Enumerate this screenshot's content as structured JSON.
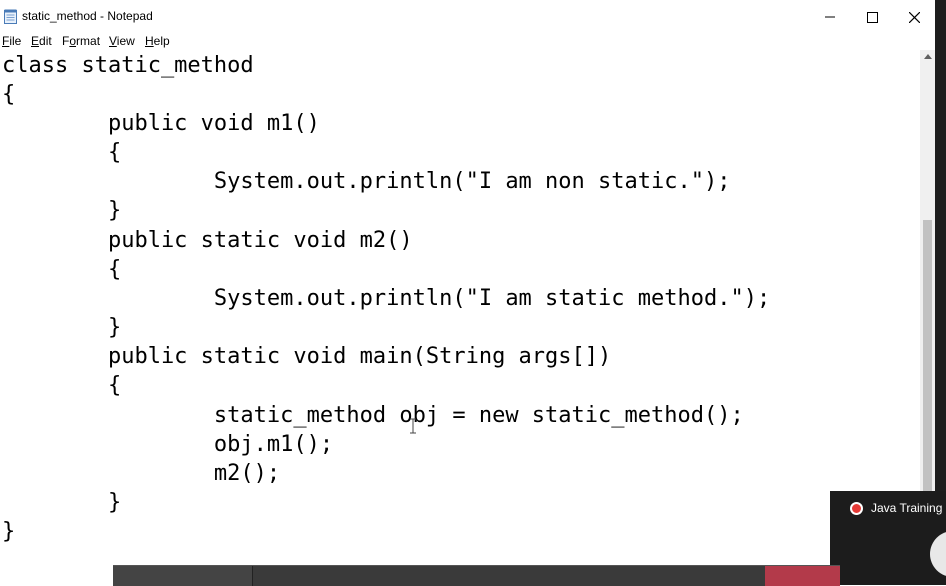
{
  "window": {
    "title": "static_method - Notepad",
    "controls": [
      "minimize",
      "maximize",
      "close"
    ]
  },
  "menu": {
    "items": [
      {
        "label": "File",
        "underline": "F",
        "rest": "ile"
      },
      {
        "label": "Edit",
        "underline": "E",
        "rest": "dit"
      },
      {
        "label": "Format",
        "underline": "o",
        "pre": "F",
        "rest": "rmat"
      },
      {
        "label": "View",
        "underline": "V",
        "rest": "iew"
      },
      {
        "label": "Help",
        "underline": "H",
        "rest": "elp"
      }
    ]
  },
  "editor": {
    "lines": [
      "class static_method",
      "{",
      "        public void m1()",
      "        {",
      "                System.out.println(\"I am non static.\");",
      "        }",
      "        public static void m2()",
      "        {",
      "                System.out.println(\"I am static method.\");",
      "        }",
      "        public static void main(String args[])",
      "        {",
      "                static_method obj = new static_method();",
      "                obj.m1();",
      "                m2();",
      "        }",
      "}"
    ]
  },
  "overlay": {
    "label": "Java Training"
  },
  "colors": {
    "recording": "#e53935",
    "taskbar": "#3a3a3a",
    "taskbar_accent": "#b33a4a"
  }
}
